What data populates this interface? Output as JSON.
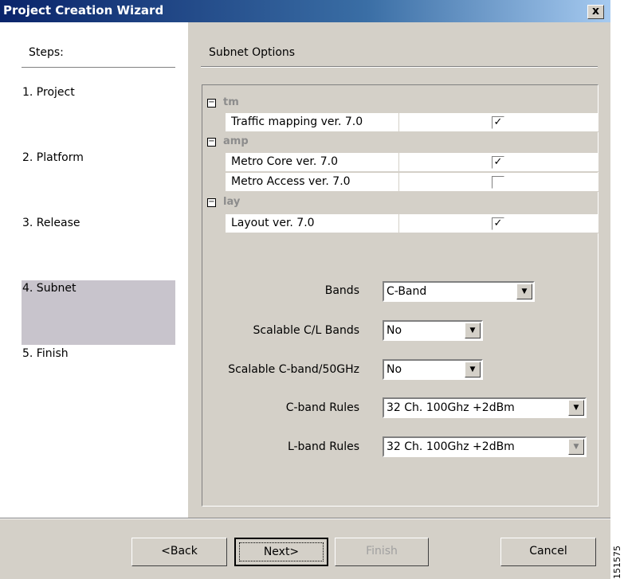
{
  "window": {
    "title": "Project Creation Wizard",
    "close_label": "x"
  },
  "steps": {
    "header": "Steps:",
    "items": [
      "1. Project",
      "2. Platform",
      "3. Release",
      "4. Subnet",
      "5. Finish"
    ],
    "active_index": 3
  },
  "main": {
    "title": "Subnet Options",
    "groups": [
      {
        "name": "tm",
        "items": [
          {
            "label": "Traffic mapping ver. 7.0",
            "checked": true
          }
        ]
      },
      {
        "name": "amp",
        "items": [
          {
            "label": "Metro Core ver. 7.0",
            "checked": true
          },
          {
            "label": "Metro Access ver. 7.0",
            "checked": false
          }
        ]
      },
      {
        "name": "lay",
        "items": [
          {
            "label": "Layout ver. 7.0",
            "checked": true
          }
        ]
      }
    ],
    "fields": {
      "bands": {
        "label": "Bands",
        "value": "C-Band"
      },
      "scalable_cl": {
        "label": "Scalable C/L Bands",
        "value": "No"
      },
      "scalable_c50": {
        "label": "Scalable C-band/50GHz",
        "value": "No"
      },
      "c_rules": {
        "label": "C-band Rules",
        "value": "32 Ch. 100Ghz +2dBm"
      },
      "l_rules": {
        "label": "L-band Rules",
        "value": "32 Ch. 100Ghz +2dBm"
      }
    }
  },
  "buttons": {
    "back": "<Back",
    "next": "Next>",
    "finish": "Finish",
    "cancel": "Cancel"
  },
  "figure_id": "151575",
  "colors": {
    "title_gradient_start": "#0a246a",
    "dialog_bg": "#d4d0c8",
    "active_step_bg": "#c8c4cc",
    "group_header_text": "#8c8c8c"
  }
}
